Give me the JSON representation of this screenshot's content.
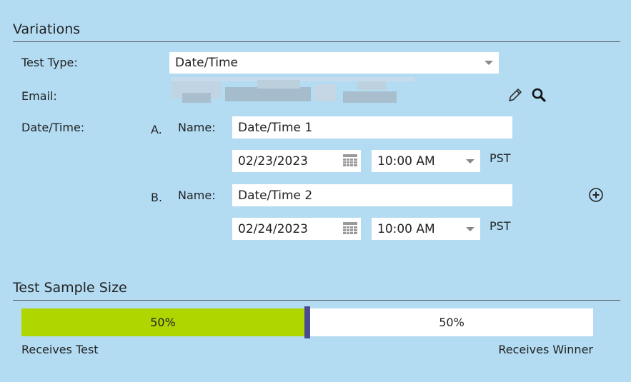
{
  "variations": {
    "title": "Variations",
    "test_type_label": "Test Type:",
    "test_type_value": "Date/Time",
    "email_label": "Email:",
    "datetime_label": "Date/Time:",
    "rows": [
      {
        "letter": "A.",
        "name_label": "Name:",
        "name_value": "Date/Time 1",
        "date": "02/23/2023",
        "time": "10:00 AM",
        "tz": "PST"
      },
      {
        "letter": "B.",
        "name_label": "Name:",
        "name_value": "Date/Time 2",
        "date": "02/24/2023",
        "time": "10:00 AM",
        "tz": "PST"
      }
    ],
    "icons": {
      "edit": "pencil-icon",
      "search": "search-icon",
      "add": "add-circle-icon",
      "calendar": "calendar-icon",
      "dropdown": "chevron-down-icon"
    }
  },
  "sample_size": {
    "title": "Test Sample Size",
    "test_percent_label": "50%",
    "winner_percent_label": "50%",
    "test_fraction": 0.5,
    "left_caption": "Receives Test",
    "right_caption": "Receives Winner"
  },
  "colors": {
    "background": "#b3dcf3",
    "test_bar": "#b0d600",
    "handle": "#4d4a94"
  }
}
